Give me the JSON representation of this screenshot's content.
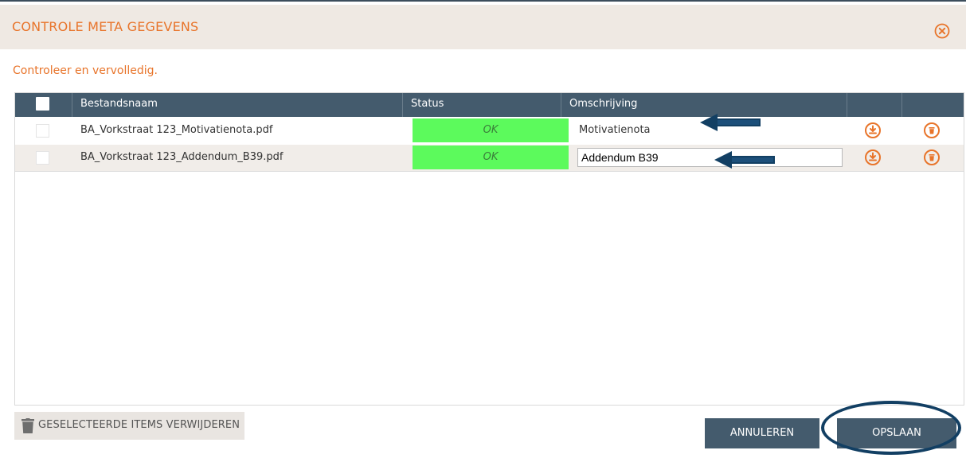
{
  "dialog": {
    "title": "CONTROLE META GEGEVENS",
    "subtitle": "Controleer en vervolledig."
  },
  "table": {
    "columns": [
      "Bestandsnaam",
      "Status",
      "Omschrijving"
    ],
    "rows": [
      {
        "filename": "BA_Vorkstraat 123_Motivatienota.pdf",
        "status": "OK",
        "description": "Motivatienota"
      },
      {
        "filename": "BA_Vorkstraat 123_Addendum_B39.pdf",
        "status": "OK",
        "description": "Addendum B39"
      }
    ]
  },
  "footer": {
    "remove_label": "GESELECTEERDE ITEMS VERWIJDEREN",
    "cancel_label": "ANNULEREN",
    "save_label": "OPSLAAN"
  },
  "colors": {
    "accent": "#e8742a",
    "header_bg": "#445b6d",
    "status_ok": "#5cfa5c",
    "annotation": "#123f63"
  },
  "icons": [
    "close-circle-icon",
    "download-icon",
    "trash-icon",
    "arrow-left-icon"
  ]
}
